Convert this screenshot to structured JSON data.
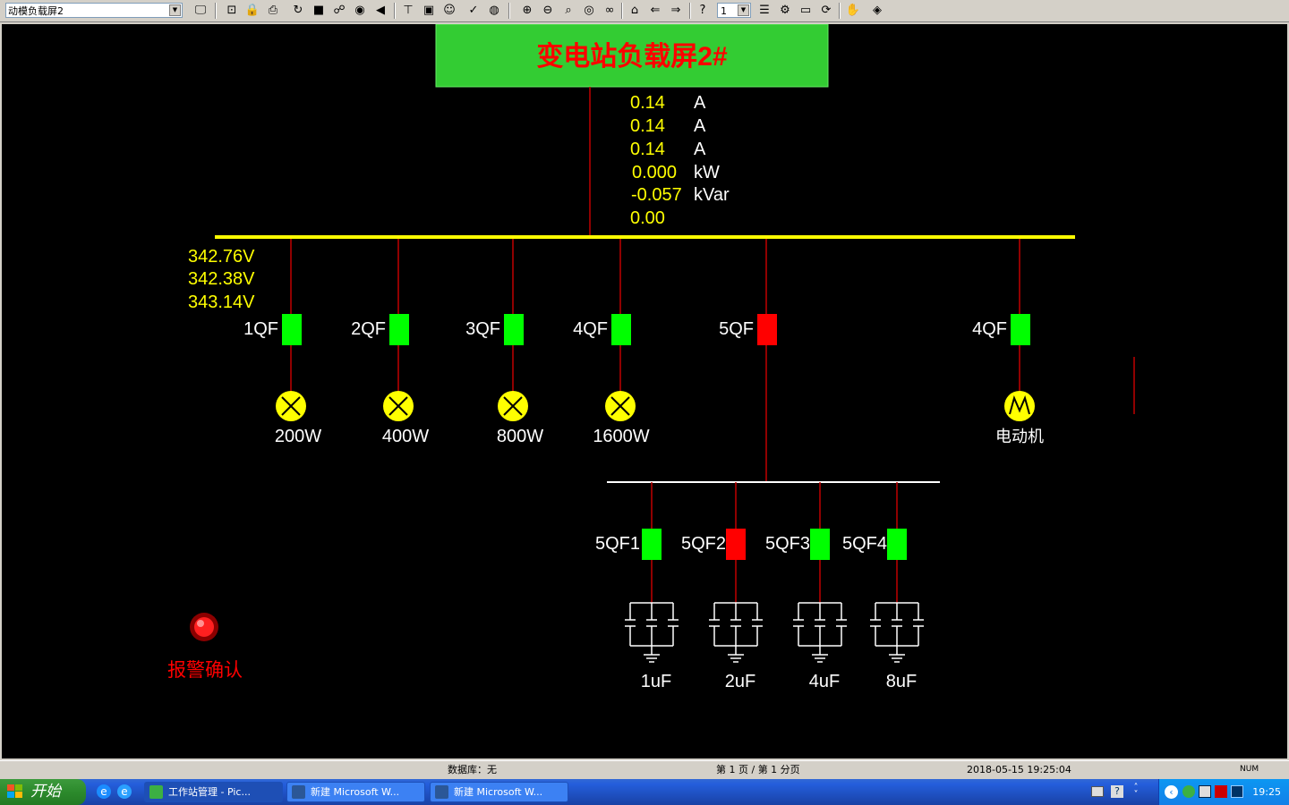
{
  "toolbar": {
    "page_select_value": "动模负载屏2",
    "zoom_select_value": "1"
  },
  "diagram": {
    "title": "变电站负载屏2#",
    "readings": {
      "ia": "0.14",
      "ib": "0.14",
      "ic": "0.14",
      "p": "0.000",
      "q": "-0.057",
      "pf": "0.00",
      "unit_a": "A",
      "unit_kw": "kW",
      "unit_kvar": "kVar"
    },
    "voltages": [
      "342.76V",
      "342.38V",
      "343.14V"
    ],
    "breakers": [
      {
        "label": "1QF",
        "state": "closed"
      },
      {
        "label": "2QF",
        "state": "closed"
      },
      {
        "label": "3QF",
        "state": "closed"
      },
      {
        "label": "4QF",
        "state": "closed"
      },
      {
        "label": "5QF",
        "state": "open"
      },
      {
        "label": "4QF",
        "state": "closed"
      }
    ],
    "loads": [
      "200W",
      "400W",
      "800W",
      "1600W"
    ],
    "motor_label": "电动机",
    "cap_breakers": [
      {
        "label": "5QF1",
        "state": "closed"
      },
      {
        "label": "5QF2",
        "state": "open"
      },
      {
        "label": "5QF3",
        "state": "closed"
      },
      {
        "label": "5QF4",
        "state": "closed"
      }
    ],
    "capacitors": [
      "1uF",
      "2uF",
      "4uF",
      "8uF"
    ],
    "alarm_label": "报警确认",
    "colors": {
      "closed": "#00ff00",
      "open": "#ff0000",
      "bus": "#ffff00",
      "line": "#c00000",
      "value": "#ffff00",
      "title_text": "#ff0000",
      "title_bg": "#33cc33"
    }
  },
  "statusbar": {
    "database": "数据库：无",
    "page_info": "第 1 页 / 第 1 分页",
    "datetime": "2018-05-15 19:25:04",
    "num": "NUM"
  },
  "taskbar": {
    "start_label": "开始",
    "tasks": [
      "工作站管理 - Pic...",
      "新建 Microsoft W...",
      "新建 Microsoft W..."
    ],
    "clock": "19:25"
  }
}
